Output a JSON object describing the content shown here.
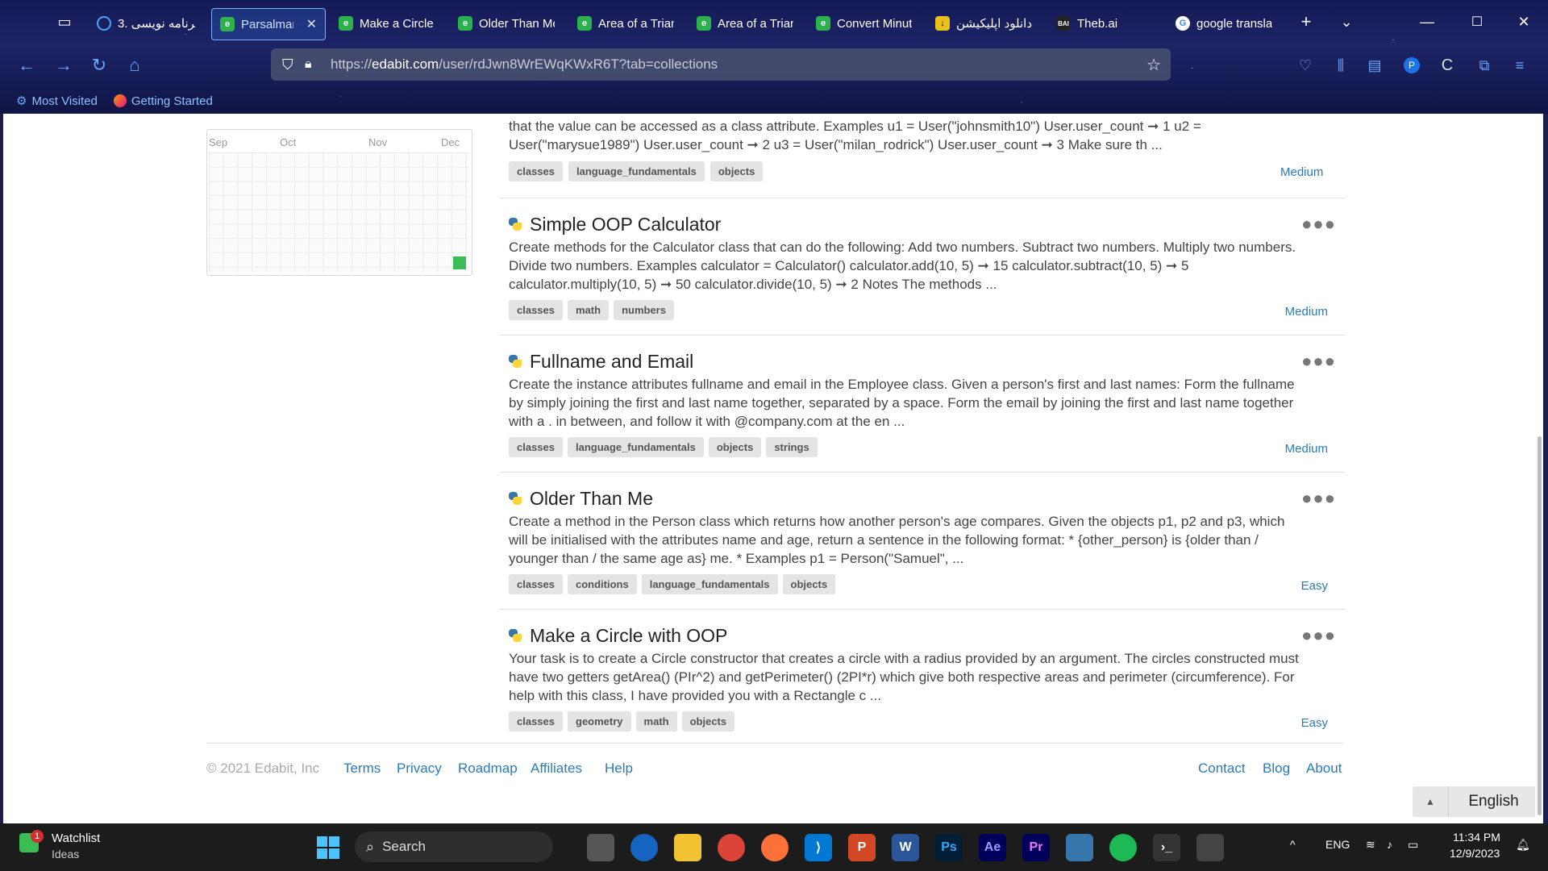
{
  "tabs": [
    {
      "title": "3. برنامه نویسی",
      "icon": "q-icon"
    },
    {
      "title": "Parsalmani",
      "icon": "edabit-icon",
      "active": true
    },
    {
      "title": "Make a Circle",
      "icon": "edabit-icon"
    },
    {
      "title": "Older Than Me",
      "icon": "edabit-icon"
    },
    {
      "title": "Area of a Trian",
      "icon": "edabit-icon"
    },
    {
      "title": "Area of a Trian",
      "icon": "edabit-icon"
    },
    {
      "title": "Convert Minut",
      "icon": "edabit-icon"
    },
    {
      "title": "دانلود اپلیکیشن",
      "icon": "download-icon"
    },
    {
      "title": "Theb.ai",
      "icon": "theb-icon"
    },
    {
      "title": "google transla",
      "icon": "google-icon"
    }
  ],
  "address": {
    "prefix": "https://",
    "domain": "edabit.com",
    "path": "/user/rdJwn8WrEWqKWxR6T?tab=collections"
  },
  "bookmarks": [
    {
      "label": "Most Visited"
    },
    {
      "label": "Getting Started"
    }
  ],
  "heatmap": {
    "months": [
      "Sep",
      "Oct",
      "Nov",
      "Dec"
    ]
  },
  "top_item": {
    "desc": "that the value can be accessed as a class attribute. Examples u1 = User(\"johnsmith10\") User.user_count ➞ 1 u2 = User(\"marysue1989\") User.user_count ➞ 2 u3 = User(\"milan_rodrick\") User.user_count ➞ 3 Make sure th ...",
    "tags": [
      "classes",
      "language_fundamentals",
      "objects"
    ],
    "difficulty": "Medium"
  },
  "items": [
    {
      "title": "Simple OOP Calculator",
      "desc": "Create methods for the Calculator class that can do the following: Add two numbers. Subtract two numbers. Multiply two numbers. Divide two numbers. Examples calculator = Calculator() calculator.add(10, 5) ➞ 15 calculator.subtract(10, 5) ➞ 5 calculator.multiply(10, 5) ➞ 50 calculator.divide(10, 5) ➞ 2 Notes The methods ...",
      "tags": [
        "classes",
        "math",
        "numbers"
      ],
      "difficulty": "Medium"
    },
    {
      "title": "Fullname and Email",
      "desc": "Create the instance attributes fullname and email in the Employee class. Given a person's first and last names: Form the fullname by simply joining the first and last name together, separated by a space. Form the email by joining the first and last name together with a . in between, and follow it with @company.com at the en ...",
      "tags": [
        "classes",
        "language_fundamentals",
        "objects",
        "strings"
      ],
      "difficulty": "Medium"
    },
    {
      "title": "Older Than Me",
      "desc": "Create a method in the Person class which returns how another person's age compares. Given the objects p1, p2 and p3, which will be initialised with the attributes name and age, return a sentence in the following format: * {other_person} is {older than / younger than / the same age as} me. * Examples p1 = Person(\"Samuel\", ...",
      "tags": [
        "classes",
        "conditions",
        "language_fundamentals",
        "objects"
      ],
      "difficulty": "Easy"
    },
    {
      "title": "Make a Circle with OOP",
      "desc": "Your task is to create a Circle constructor that creates a circle with a radius provided by an argument. The circles constructed must have two getters getArea() (PIr^2) and getPerimeter() (2PI*r) which give both respective areas and perimeter (circumference). For help with this class, I have provided you with a Rectangle c ...",
      "tags": [
        "classes",
        "geometry",
        "math",
        "objects"
      ],
      "difficulty": "Easy"
    }
  ],
  "footer": {
    "copyright": "© 2021 Edabit, Inc",
    "links_left": [
      "Terms",
      "Privacy",
      "Roadmap",
      "Affiliates",
      "Help"
    ],
    "links_right": [
      "Contact",
      "Blog",
      "About"
    ],
    "language": "English"
  },
  "taskbar": {
    "watchlist": "Watchlist",
    "watchlist_sub": "Ideas",
    "notif_count": "1",
    "search_placeholder": "Search",
    "lang": "ENG",
    "time": "11:34 PM",
    "date": "12/9/2023"
  },
  "colors": {
    "accent": "#2b7bb9",
    "edabit_green": "#2bb24c",
    "tag_bg": "#e4e4e4"
  }
}
